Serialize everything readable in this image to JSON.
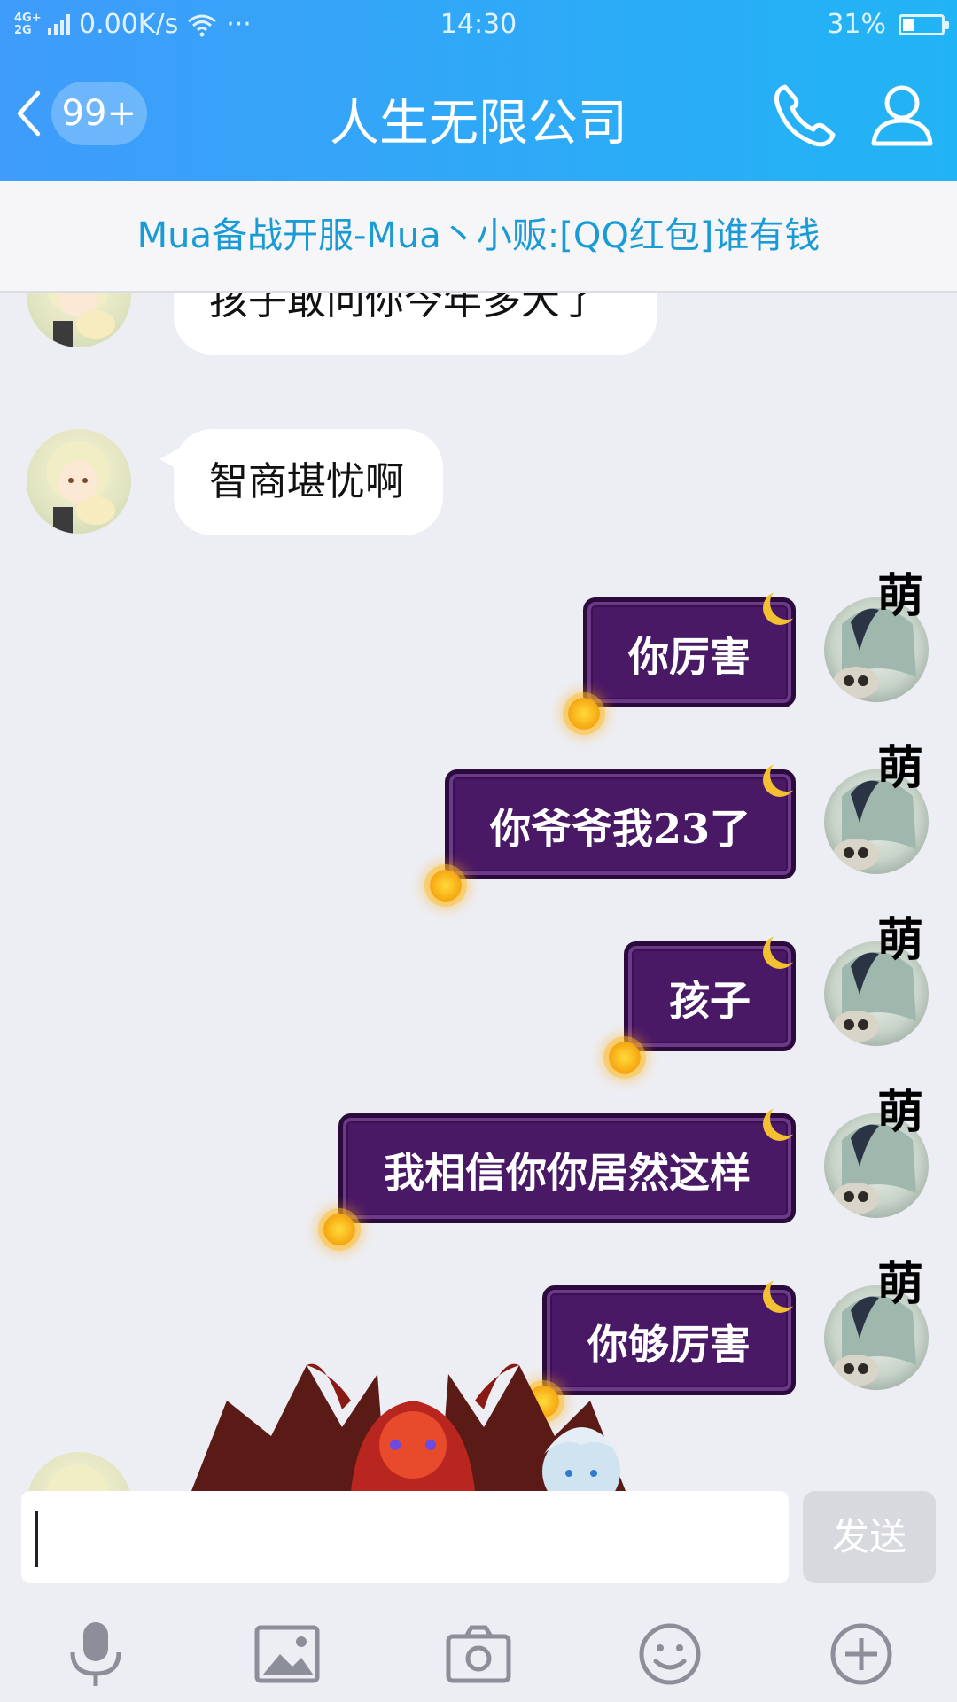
{
  "status_bar": {
    "network": "4G+\n2G",
    "speed": "0.00K/s",
    "dots": "···",
    "time": "14:30",
    "battery_text": "31%",
    "battery_level": 0.31
  },
  "header": {
    "unread_count": "99+",
    "title": "人生无限公司"
  },
  "pinned_notice": "Mua备战开服-Mua丶小贩:[QQ红包]谁有钱",
  "messages_in": [
    {
      "text": "孩子敢问你今年多大了"
    },
    {
      "text": "智商堪忧啊"
    }
  ],
  "messages_out": [
    {
      "text": "你厉害",
      "tag": "萌"
    },
    {
      "text": "你爷爷我23了",
      "tag": "萌"
    },
    {
      "text": "孩子",
      "tag": "萌"
    },
    {
      "text": "我相信你你居然这样",
      "tag": "萌"
    },
    {
      "text": "你够厉害",
      "tag": "萌"
    }
  ],
  "input": {
    "value": "",
    "send_label": "发送"
  },
  "toolbar": [
    "mic-icon",
    "image-icon",
    "camera-icon",
    "emoji-icon",
    "plus-icon"
  ],
  "colors": {
    "header_start": "#3f9cfb",
    "header_end": "#21b4f4",
    "notice_text": "#1a9bd6",
    "bubble_out": "#4a1966",
    "background": "#edeef3"
  }
}
